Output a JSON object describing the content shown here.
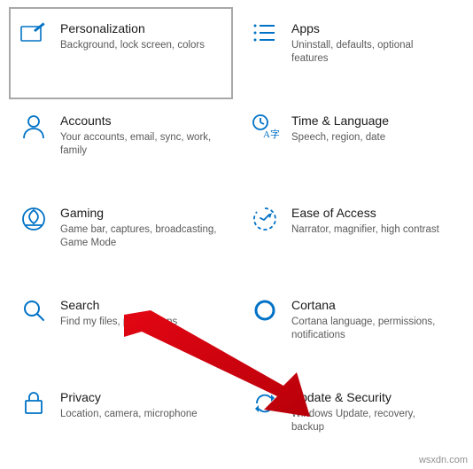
{
  "watermark": "wsxdn.com",
  "categories": [
    {
      "key": "personalization",
      "title": "Personalization",
      "desc": "Background, lock screen, colors"
    },
    {
      "key": "apps",
      "title": "Apps",
      "desc": "Uninstall, defaults, optional features"
    },
    {
      "key": "accounts",
      "title": "Accounts",
      "desc": "Your accounts, email, sync, work, family"
    },
    {
      "key": "time",
      "title": "Time & Language",
      "desc": "Speech, region, date"
    },
    {
      "key": "gaming",
      "title": "Gaming",
      "desc": "Game bar, captures, broadcasting, Game Mode"
    },
    {
      "key": "ease",
      "title": "Ease of Access",
      "desc": "Narrator, magnifier, high contrast"
    },
    {
      "key": "search",
      "title": "Search",
      "desc": "Find my files, permissions"
    },
    {
      "key": "cortana",
      "title": "Cortana",
      "desc": "Cortana language, permissions, notifications"
    },
    {
      "key": "privacy",
      "title": "Privacy",
      "desc": "Location, camera, microphone"
    },
    {
      "key": "update",
      "title": "Update & Security",
      "desc": "Windows Update, recovery, backup"
    }
  ],
  "icons": {
    "color": "#0072c6"
  },
  "arrow_color": "#e30613"
}
